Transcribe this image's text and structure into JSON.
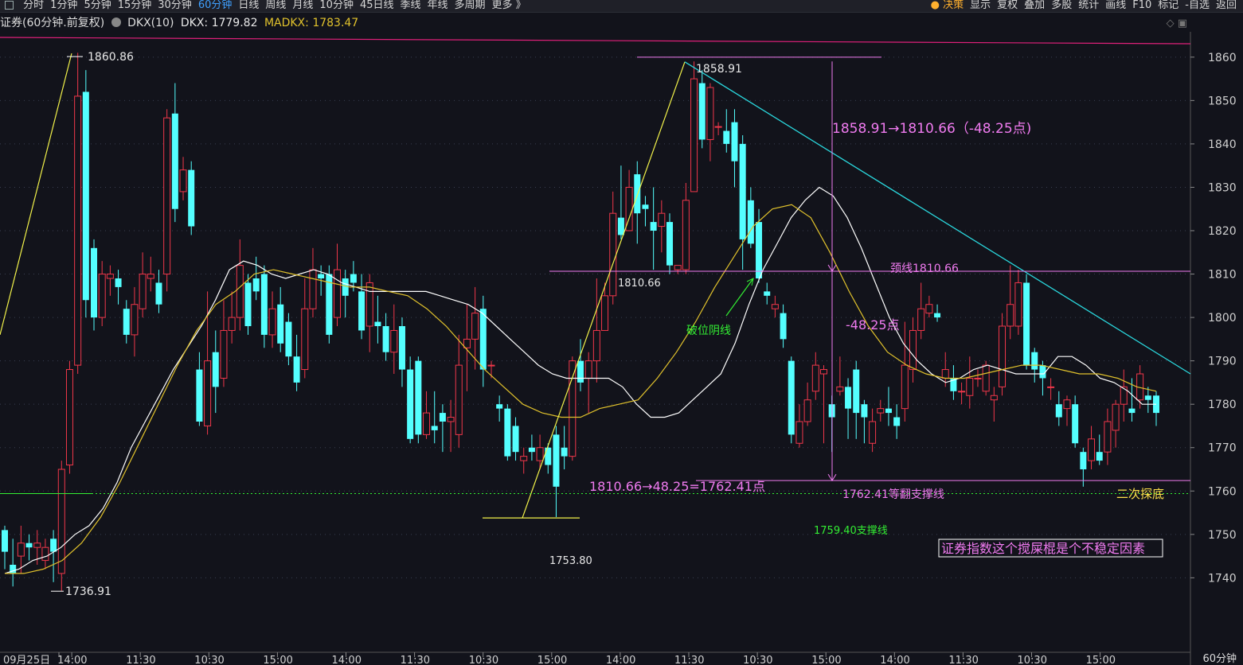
{
  "toolbar": {
    "left_items": [
      {
        "label": "分时",
        "active": false
      },
      {
        "label": "1分钟",
        "active": false
      },
      {
        "label": "5分钟",
        "active": false
      },
      {
        "label": "15分钟",
        "active": false
      },
      {
        "label": "30分钟",
        "active": false
      },
      {
        "label": "60分钟",
        "active": true
      },
      {
        "label": "日线",
        "active": false
      },
      {
        "label": "周线",
        "active": false
      },
      {
        "label": "月线",
        "active": false
      },
      {
        "label": "10分钟",
        "active": false
      },
      {
        "label": "45日线",
        "active": false
      },
      {
        "label": "季线",
        "active": false
      },
      {
        "label": "年线",
        "active": false
      },
      {
        "label": "多周期",
        "active": false
      },
      {
        "label": "更多 》",
        "active": false
      }
    ],
    "right_items": [
      "决策",
      "显示",
      "复权",
      "叠加",
      "多股",
      "统计",
      "画线",
      "F10",
      "标记",
      "-自选",
      "返回"
    ]
  },
  "indicator": {
    "title": "证券(60分钟.前复权)",
    "param": "DKX(10)",
    "dkx": "DKX: 1779.82",
    "madkx": "MADKX: 1783.47"
  },
  "colors": {
    "up": "#f0374a",
    "down": "#54ffff",
    "dkx": "#ffffff",
    "madkx": "#e1c22c",
    "annot_pink": "#f07bf0",
    "annot_green": "#33ee33",
    "annot_yellow": "#f2f24a",
    "trend_cyan": "#2ad8de",
    "axis": "#cfcfcf",
    "grid": "#3a3f52"
  },
  "chart_data": {
    "type": "candlestick",
    "title": "证券(60分钟.前复权)",
    "period_label": "60分钟",
    "ylim": [
      1732,
      1864
    ],
    "y_ticks": [
      1740,
      1750,
      1760,
      1770,
      1780,
      1790,
      1800,
      1810,
      1820,
      1830,
      1840,
      1850,
      1860
    ],
    "x_labels": [
      "09月25日",
      "14:00",
      "11:30",
      "10:30",
      "15:00",
      "14:00",
      "11:30",
      "10:30",
      "15:00",
      "14:00",
      "11:30",
      "10:30",
      "15:00",
      "14:00",
      "11:30",
      "10:30",
      "15:00"
    ],
    "candles": [
      [
        1751,
        1746,
        1752,
        1742
      ],
      [
        1743,
        1741,
        1749,
        1738
      ],
      [
        1745,
        1748,
        1752,
        1741
      ],
      [
        1748,
        1747,
        1750,
        1744
      ],
      [
        1747,
        1748,
        1751,
        1743
      ],
      [
        1744,
        1747,
        1749,
        1742
      ],
      [
        1749,
        1746,
        1751,
        1739
      ],
      [
        1741,
        1765,
        1767,
        1737
      ],
      [
        1766,
        1788,
        1790,
        1764
      ],
      [
        1789,
        1851,
        1861,
        1787
      ],
      [
        1852,
        1804,
        1857,
        1800
      ],
      [
        1816,
        1800,
        1818,
        1797
      ],
      [
        1800,
        1810,
        1813,
        1798
      ],
      [
        1809,
        1810,
        1812,
        1805
      ],
      [
        1809,
        1807,
        1811,
        1803
      ],
      [
        1802,
        1796,
        1804,
        1794
      ],
      [
        1796,
        1803,
        1807,
        1791
      ],
      [
        1802,
        1810,
        1815,
        1800
      ],
      [
        1809,
        1810,
        1814,
        1806
      ],
      [
        1808,
        1803,
        1811,
        1801
      ],
      [
        1810,
        1846,
        1848,
        1806
      ],
      [
        1847,
        1825,
        1854,
        1822
      ],
      [
        1829,
        1834,
        1837,
        1827
      ],
      [
        1834,
        1821,
        1836,
        1819
      ],
      [
        1788,
        1776,
        1792,
        1775
      ],
      [
        1775,
        1790,
        1806,
        1773
      ],
      [
        1792,
        1784,
        1797,
        1778
      ],
      [
        1786,
        1797,
        1804,
        1784
      ],
      [
        1797,
        1800,
        1806,
        1794
      ],
      [
        1800,
        1812,
        1818,
        1797
      ],
      [
        1808,
        1798,
        1810,
        1796
      ],
      [
        1809,
        1806,
        1814,
        1804
      ],
      [
        1810,
        1796,
        1812,
        1793
      ],
      [
        1796,
        1802,
        1806,
        1793
      ],
      [
        1803,
        1794,
        1807,
        1792
      ],
      [
        1799,
        1791,
        1801,
        1789
      ],
      [
        1791,
        1785,
        1796,
        1783
      ],
      [
        1788,
        1802,
        1809,
        1786
      ],
      [
        1802,
        1811,
        1816,
        1800
      ],
      [
        1810,
        1809,
        1812,
        1805
      ],
      [
        1810,
        1796,
        1812,
        1794
      ],
      [
        1800,
        1811,
        1817,
        1798
      ],
      [
        1809,
        1805,
        1811,
        1800
      ],
      [
        1810,
        1808,
        1813,
        1806
      ],
      [
        1806,
        1797,
        1810,
        1795
      ],
      [
        1798,
        1808,
        1810,
        1792
      ],
      [
        1799,
        1798,
        1805,
        1794
      ],
      [
        1798,
        1792,
        1801,
        1790
      ],
      [
        1792,
        1797,
        1803,
        1787
      ],
      [
        1798,
        1788,
        1800,
        1784
      ],
      [
        1788,
        1772,
        1791,
        1771
      ],
      [
        1790,
        1773,
        1791,
        1771
      ],
      [
        1773,
        1778,
        1783,
        1772
      ],
      [
        1775,
        1774,
        1783,
        1771
      ],
      [
        1778,
        1776,
        1780,
        1769
      ],
      [
        1776,
        1777,
        1781,
        1769
      ],
      [
        1773,
        1789,
        1796,
        1770
      ],
      [
        1793,
        1795,
        1803,
        1783
      ],
      [
        1795,
        1801,
        1807,
        1788
      ],
      [
        1802,
        1788,
        1805,
        1784
      ],
      [
        1789,
        1789,
        1790,
        1786
      ],
      [
        1780,
        1779,
        1782,
        1776
      ],
      [
        1779,
        1768,
        1780,
        1767
      ],
      [
        1775,
        1769,
        1777,
        1767
      ],
      [
        1767,
        1768,
        1770,
        1764
      ],
      [
        1770,
        1769,
        1773,
        1767
      ],
      [
        1767,
        1770,
        1773,
        1765
      ],
      [
        1770,
        1766,
        1771,
        1764
      ],
      [
        1773,
        1761,
        1775,
        1754
      ],
      [
        1770,
        1768,
        1775,
        1765
      ],
      [
        1768,
        1790,
        1791,
        1767
      ],
      [
        1790,
        1785,
        1795,
        1783
      ],
      [
        1786,
        1790,
        1792,
        1778
      ],
      [
        1790,
        1797,
        1809,
        1785
      ],
      [
        1797,
        1805,
        1808,
        1797
      ],
      [
        1805,
        1824,
        1829,
        1803
      ],
      [
        1823,
        1819,
        1835,
        1818
      ],
      [
        1820,
        1830,
        1834,
        1820
      ],
      [
        1833,
        1824,
        1836,
        1817
      ],
      [
        1826,
        1825,
        1828,
        1821
      ],
      [
        1822,
        1820,
        1830,
        1811
      ],
      [
        1821,
        1824,
        1827,
        1815
      ],
      [
        1822,
        1812,
        1824,
        1810
      ],
      [
        1811,
        1812,
        1812,
        1810
      ],
      [
        1811,
        1827,
        1831,
        1810
      ],
      [
        1829,
        1855,
        1859,
        1829
      ],
      [
        1854,
        1841,
        1857,
        1839
      ],
      [
        1841,
        1853,
        1854,
        1836
      ],
      [
        1844,
        1844,
        1845,
        1842
      ],
      [
        1843,
        1840,
        1848,
        1838
      ],
      [
        1845,
        1836,
        1848,
        1830
      ],
      [
        1840,
        1818,
        1842,
        1811
      ],
      [
        1827,
        1817,
        1830,
        1816
      ],
      [
        1822,
        1809,
        1825,
        1808
      ],
      [
        1806,
        1805,
        1808,
        1803
      ],
      [
        1802,
        1803,
        1805,
        1800
      ],
      [
        1801,
        1795,
        1803,
        1793
      ],
      [
        1790,
        1773,
        1791,
        1771
      ],
      [
        1771,
        1776,
        1780,
        1770
      ],
      [
        1776,
        1781,
        1785,
        1775
      ],
      [
        1783,
        1789,
        1792,
        1781
      ],
      [
        1787,
        1788,
        1789,
        1771
      ],
      [
        1780,
        1777,
        1782,
        1769
      ],
      [
        1783,
        1784,
        1791,
        1782
      ],
      [
        1784,
        1779,
        1786,
        1772
      ],
      [
        1788,
        1778,
        1790,
        1772
      ],
      [
        1780,
        1777,
        1781,
        1771
      ],
      [
        1771,
        1776,
        1779,
        1769
      ],
      [
        1778,
        1779,
        1781,
        1776
      ],
      [
        1779,
        1778,
        1784,
        1775
      ],
      [
        1777,
        1775,
        1780,
        1772
      ],
      [
        1779,
        1789,
        1799,
        1776
      ],
      [
        1788,
        1797,
        1800,
        1785
      ],
      [
        1797,
        1802,
        1808,
        1795
      ],
      [
        1801,
        1803,
        1805,
        1800
      ],
      [
        1801,
        1800,
        1803,
        1799
      ],
      [
        1786,
        1788,
        1792,
        1784
      ],
      [
        1786,
        1783,
        1789,
        1781
      ],
      [
        1783,
        1783,
        1785,
        1780
      ],
      [
        1782,
        1786,
        1791,
        1779
      ],
      [
        1786,
        1786,
        1788,
        1784
      ],
      [
        1783,
        1789,
        1790,
        1782
      ],
      [
        1781,
        1782,
        1784,
        1776
      ],
      [
        1784,
        1798,
        1801,
        1782
      ],
      [
        1798,
        1803,
        1812,
        1795
      ],
      [
        1798,
        1808,
        1811,
        1796
      ],
      [
        1808,
        1789,
        1810,
        1788
      ],
      [
        1792,
        1788,
        1793,
        1785
      ],
      [
        1789,
        1786,
        1790,
        1782
      ],
      [
        1784,
        1784,
        1786,
        1781
      ],
      [
        1780,
        1777,
        1783,
        1775
      ],
      [
        1779,
        1781,
        1782,
        1775
      ],
      [
        1780,
        1771,
        1782,
        1770
      ],
      [
        1769,
        1765,
        1770,
        1761
      ],
      [
        1767,
        1772,
        1775,
        1765
      ],
      [
        1769,
        1767,
        1773,
        1766
      ],
      [
        1769,
        1776,
        1779,
        1766
      ],
      [
        1774,
        1780,
        1781,
        1770
      ],
      [
        1780,
        1784,
        1788,
        1776
      ],
      [
        1779,
        1778,
        1786,
        1776
      ],
      [
        1781,
        1787,
        1789,
        1779
      ],
      [
        1782,
        1781,
        1784,
        1778
      ],
      [
        1782,
        1778,
        1783,
        1775
      ]
    ],
    "series": [
      {
        "name": "DKX",
        "values": [
          1741,
          1742,
          1744,
          1745,
          1747,
          1750,
          1752,
          1756,
          1762,
          1770,
          1776,
          1782,
          1788,
          1793,
          1798,
          1804,
          1811,
          1813,
          1812,
          1810,
          1809,
          1810,
          1811,
          1810,
          1808,
          1807,
          1806,
          1806,
          1806,
          1806,
          1806,
          1805,
          1804,
          1803,
          1801,
          1798,
          1795,
          1792,
          1789,
          1787,
          1786,
          1786,
          1786,
          1786,
          1784,
          1780,
          1777,
          1777,
          1778,
          1781,
          1784,
          1787,
          1794,
          1803,
          1811,
          1817,
          1823,
          1827,
          1830,
          1828,
          1823,
          1816,
          1808,
          1800,
          1794,
          1790,
          1787,
          1785,
          1786,
          1788,
          1789,
          1788,
          1787,
          1787,
          1787,
          1791,
          1791,
          1789,
          1786,
          1785,
          1783,
          1780,
          1780
        ]
      },
      {
        "name": "MADKX",
        "values": [
          1741,
          1741,
          1742,
          1744,
          1748,
          1754,
          1762,
          1771,
          1780,
          1789,
          1797,
          1803,
          1806,
          1810,
          1811,
          1810,
          1809,
          1808,
          1807,
          1807,
          1806,
          1805,
          1802,
          1798,
          1793,
          1788,
          1784,
          1780,
          1778,
          1777,
          1777,
          1779,
          1780,
          1781,
          1786,
          1792,
          1799,
          1807,
          1814,
          1821,
          1825,
          1826,
          1823,
          1815,
          1806,
          1798,
          1792,
          1789,
          1787,
          1786,
          1786,
          1787,
          1788,
          1789,
          1789,
          1788,
          1787,
          1787,
          1786,
          1784,
          1783
        ]
      }
    ],
    "annotations": {
      "high1_label": "1860.86",
      "low1_label": "1736.91",
      "high2_label": "1858.91",
      "neck_left_label": "1810.66",
      "low2_label": "1753.80",
      "drop_text": "1858.91→1810.66（-48.25点)",
      "neckline_text": "颈线1810.66",
      "breakdown_text": "破位阴线",
      "points_text": "-48.25点",
      "target_calc_text": "1810.66→48.25=1762.41点",
      "flip_support_text": "1762.41等翻支撑线",
      "support_text": "1759.40支撑线",
      "retest_text": "二次探底",
      "note_text": "证券指数这个搅屎棍是个不稳定因素"
    }
  }
}
